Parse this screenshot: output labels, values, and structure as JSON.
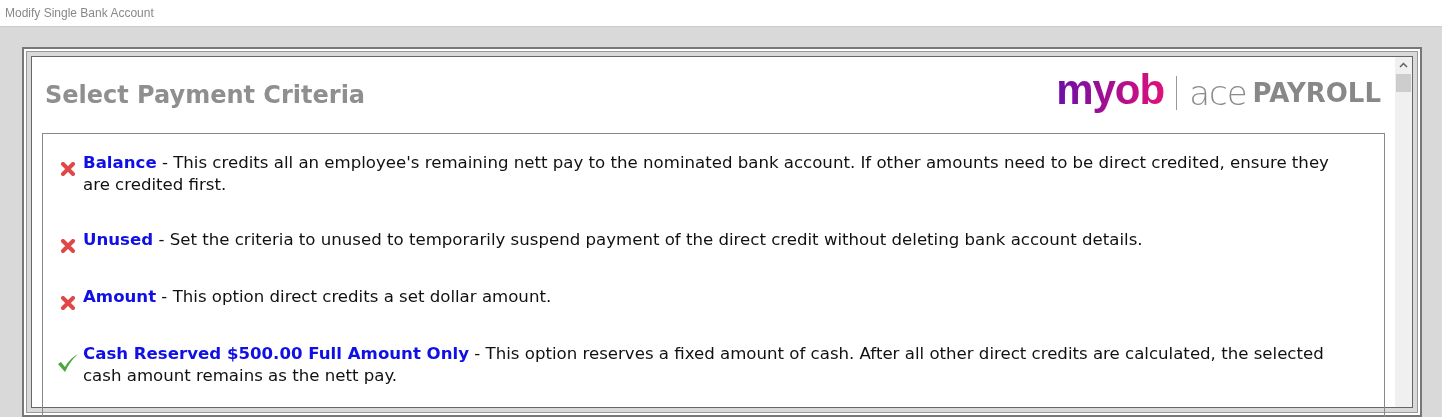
{
  "window": {
    "title": "Modify Single Bank Account"
  },
  "heading": "Select Payment Criteria",
  "logo": {
    "brand": "myob",
    "product_light": "ace",
    "product_bold": "PAYROLL"
  },
  "options": [
    {
      "label": "Balance",
      "description": " - This credits all an employee's remaining nett pay to the nominated bank account. If other amounts need to be direct credited, ensure they are credited first.",
      "selected": false
    },
    {
      "label": "Unused",
      "description": " - Set the criteria to unused to temporarily suspend payment of the direct credit without deleting bank account details.",
      "selected": false
    },
    {
      "label": "Amount",
      "description": " - This option direct credits a set dollar amount.",
      "selected": false
    },
    {
      "label": "Cash Reserved $500.00 Full Amount Only",
      "description": " - This option reserves a fixed amount of cash. After all other direct credits are calculated, the selected cash amount remains as the nett pay.",
      "selected": true
    }
  ]
}
